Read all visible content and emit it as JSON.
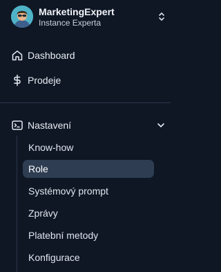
{
  "profile": {
    "name": "MarketingExpert",
    "subtitle": "Instance Experta"
  },
  "nav": {
    "items": [
      {
        "label": "Dashboard",
        "icon": "home-icon"
      },
      {
        "label": "Prodeje",
        "icon": "dollar-icon"
      }
    ]
  },
  "settings": {
    "label": "Nastavení",
    "icon": "terminal-icon",
    "expanded": true,
    "items": [
      {
        "label": "Know-how",
        "active": false
      },
      {
        "label": "Role",
        "active": true
      },
      {
        "label": "Systémový prompt",
        "active": false
      },
      {
        "label": "Zprávy",
        "active": false
      },
      {
        "label": "Platební metody",
        "active": false
      },
      {
        "label": "Konfigurace",
        "active": false
      }
    ]
  },
  "colors": {
    "background": "#0f1725",
    "active_item": "#2e3d52",
    "divider": "#2a3648",
    "text": "#e6ebf2"
  }
}
